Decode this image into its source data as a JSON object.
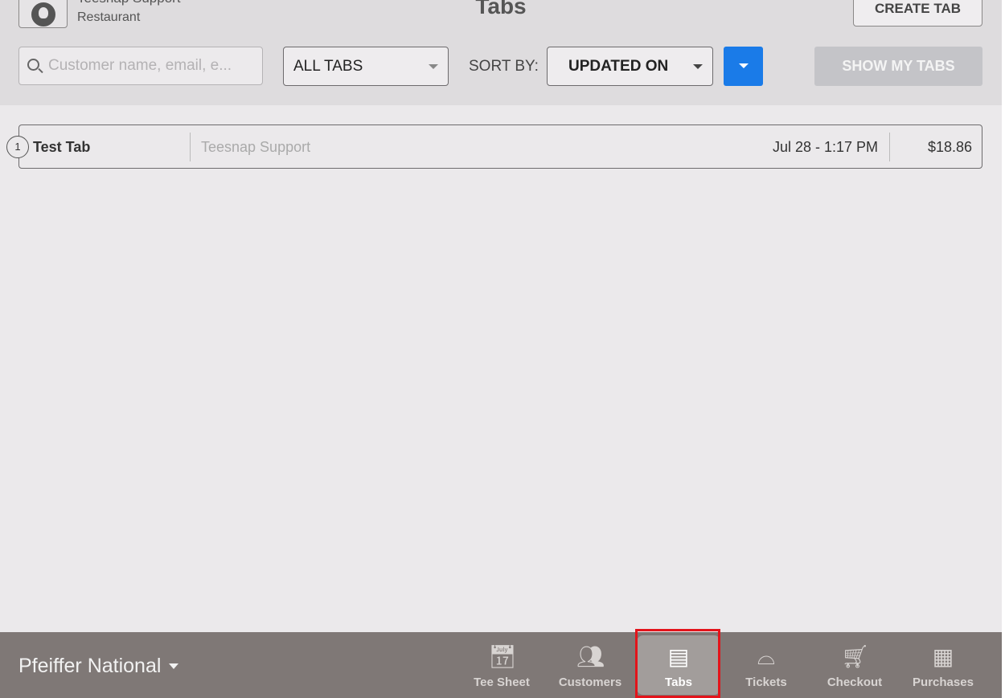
{
  "header": {
    "user_name": "Teesnap Support",
    "user_role": "Restaurant",
    "title": "Tabs",
    "create_tab_label": "CREATE TAB"
  },
  "filters": {
    "search_placeholder": "Customer name, email, e...",
    "search_value": "",
    "tab_filter": "ALL TABS",
    "sort_by_label": "SORT BY:",
    "sort_value": "UPDATED ON",
    "show_my_tabs_label": "SHOW MY TABS",
    "accent_color": "#1a7be8"
  },
  "tabs": [
    {
      "count": "1",
      "name": "Test Tab",
      "customer": "Teesnap Support",
      "updated": "Jul 28 - 1:17 PM",
      "amount": "$18.86"
    }
  ],
  "footer": {
    "venue": "Pfeiffer National",
    "nav": [
      {
        "label": "Tee Sheet",
        "icon": "calendar-icon"
      },
      {
        "label": "Customers",
        "icon": "users-icon"
      },
      {
        "label": "Tabs",
        "icon": "receipt-icon",
        "active": true
      },
      {
        "label": "Tickets",
        "icon": "cloche-icon"
      },
      {
        "label": "Checkout",
        "icon": "cart-icon"
      },
      {
        "label": "Purchases",
        "icon": "cash-register-icon"
      }
    ]
  }
}
